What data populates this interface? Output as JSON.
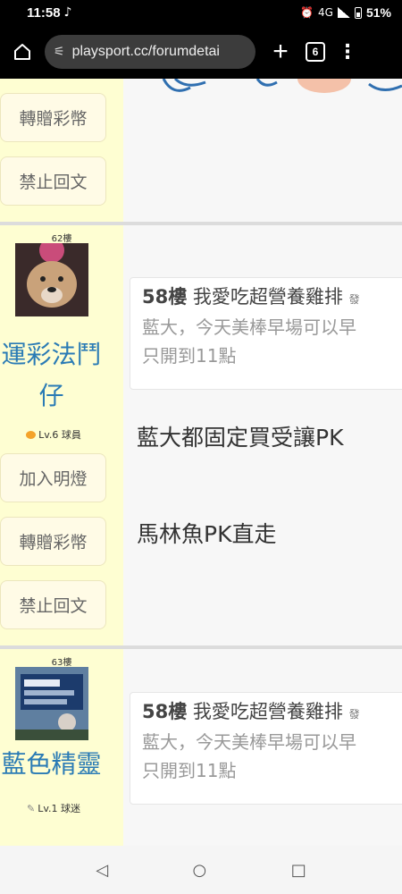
{
  "status": {
    "time": "11:58",
    "battery": "51%",
    "network": "4G"
  },
  "browser": {
    "url": "playsport.cc/forumdetai",
    "tab_count": "6"
  },
  "top_block": {
    "buttons": {
      "gift": "轉贈彩幣",
      "ban": "禁止回文"
    }
  },
  "posts": [
    {
      "floor": "62樓",
      "username_line1": "運彩法鬥",
      "username_line2": "仔",
      "level": "Lv.6 球員",
      "buttons": {
        "light": "加入明燈",
        "gift": "轉贈彩幣",
        "ban": "禁止回文"
      },
      "quote": {
        "floor": "58樓",
        "author": "我愛吃超營養雞排",
        "suffix": "發",
        "line1": "藍大，今天美棒早場可以早",
        "line2": "只開到11點"
      },
      "paragraphs": [
        "藍大都固定買受讓PK",
        "馬林魚PK直走"
      ]
    },
    {
      "floor": "63樓",
      "username_line1": "藍色精靈",
      "level": "Lv.1 球迷",
      "quote": {
        "floor": "58樓",
        "author": "我愛吃超營養雞排",
        "suffix": "發",
        "line1": "藍大，今天美棒早場可以早",
        "line2": "只開到11點"
      }
    }
  ],
  "icons": [
    "home-icon",
    "tune-icon",
    "plus-icon",
    "tab-switcher-icon",
    "more-menu-icon",
    "back-icon",
    "home-nav-icon",
    "recents-icon"
  ]
}
